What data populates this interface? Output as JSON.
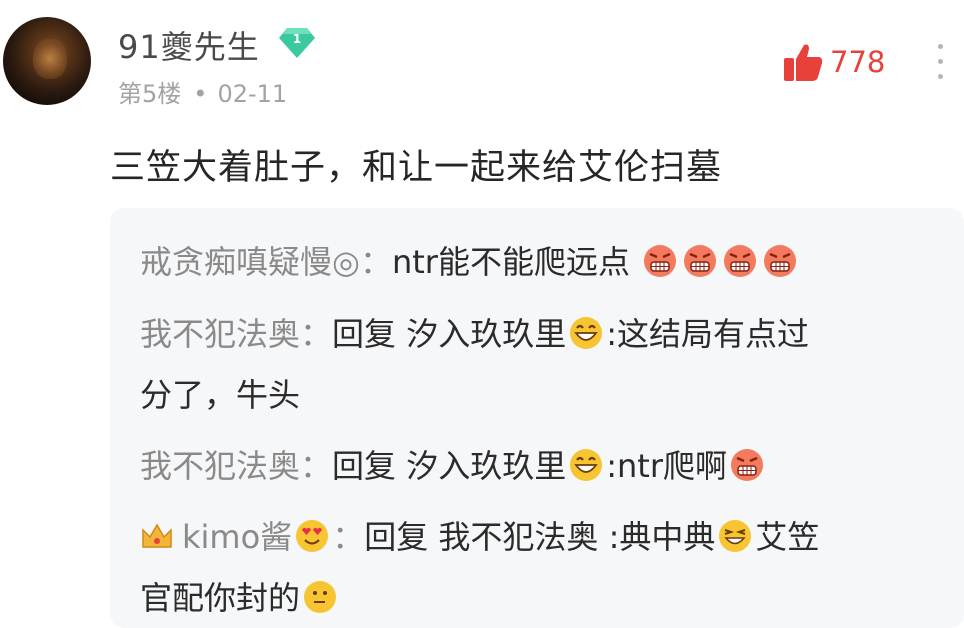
{
  "post": {
    "author": "91夔先生",
    "level": "1",
    "floor": "第5楼",
    "dot": "•",
    "date": "02-11",
    "likes": "778",
    "content": "三笠大着肚子，和让一起来给艾伦扫墓"
  },
  "replies": [
    {
      "user": "戒贪痴嗔疑慢◎",
      "sep": "：",
      "text": "ntr能不能爬远点",
      "emojis": [
        "angry-grin",
        "angry-grin",
        "angry-grin",
        "angry-grin"
      ]
    },
    {
      "user": "我不犯法奥",
      "sep": "：",
      "reply_word": "回复",
      "reply_to": "汐入玖玖里",
      "text_line1": ":这结局有点过",
      "text_line2": "分了，牛头"
    },
    {
      "user": "我不犯法奥",
      "sep": "：",
      "reply_word": "回复",
      "reply_to": "汐入玖玖里",
      "text": ":ntr爬啊"
    },
    {
      "user": "kimo酱",
      "sep": "：",
      "reply_word": "回复",
      "reply_to": "我不犯法奥",
      "text_line1": ":典中典",
      "text_line1b": "艾笠",
      "text_line2": "官配你封的"
    }
  ],
  "colors": {
    "like": "#e8403a",
    "badge": "#3bc9a0",
    "username": "#8a8a8a"
  }
}
